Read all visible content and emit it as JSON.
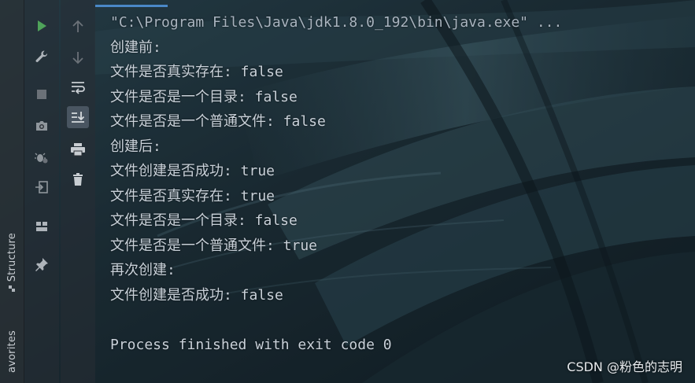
{
  "side_tabs": {
    "structure": "Structure",
    "favorites": "avorites"
  },
  "toolbar": {
    "column1": [
      "run-icon",
      "wrench-icon",
      "stop-icon",
      "camera-icon",
      "bug-settings-icon",
      "exit-icon",
      "layout-icon",
      "pin-icon"
    ],
    "column2": [
      "arrow-up-icon",
      "arrow-down-icon",
      "soft-wrap-icon",
      "scroll-to-end-icon",
      "print-icon",
      "trash-icon"
    ]
  },
  "console": {
    "command": "\"C:\\Program Files\\Java\\jdk1.8.0_192\\bin\\java.exe\" ...",
    "lines": [
      "创建前:",
      "文件是否真实存在: false",
      "文件是否是一个目录: false",
      "文件是否是一个普通文件: false",
      "创建后:",
      "文件创建是否成功: true",
      "文件是否真实存在: true",
      "文件是否是一个目录: false",
      "文件是否是一个普通文件: true",
      "再次创建:",
      "文件创建是否成功: false",
      "",
      "Process finished with exit code 0"
    ]
  },
  "watermark": "CSDN @粉色的志明",
  "colors": {
    "run_green": "#4fa35a",
    "accent_blue": "#4a88c7",
    "icon_grey": "#aeb4ba",
    "text": "#c9d1d9"
  }
}
